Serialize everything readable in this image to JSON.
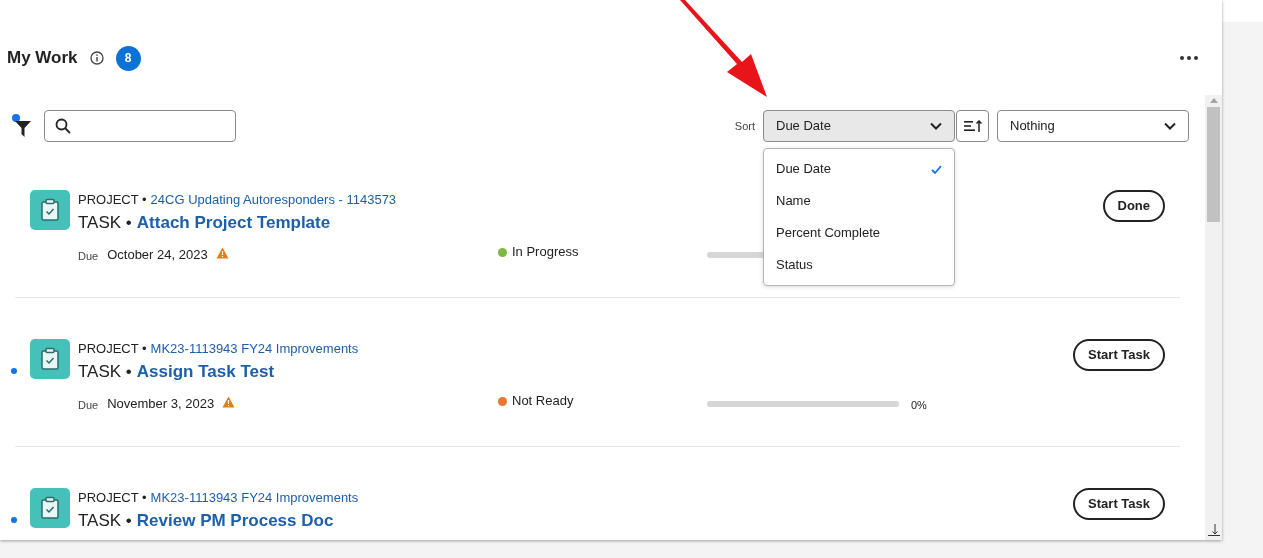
{
  "header": {
    "title": "My Work",
    "count": "8"
  },
  "filter": {
    "active": true
  },
  "sort": {
    "label": "Sort",
    "value": "Due Date",
    "open": true,
    "options": [
      {
        "label": "Due Date",
        "selected": true
      },
      {
        "label": "Name",
        "selected": false
      },
      {
        "label": "Percent Complete",
        "selected": false
      },
      {
        "label": "Status",
        "selected": false
      }
    ]
  },
  "group_by": {
    "value": "Nothing"
  },
  "tasks": [
    {
      "unread": false,
      "project_label": "PROJECT •",
      "project": "24CG Updating Autoresponders - 1143573",
      "task_label": "TASK •",
      "task": "Attach Project Template",
      "due_label": "Due",
      "due": "October 24, 2023",
      "overdue": true,
      "status": "In Progress",
      "color": "#7cb944",
      "level": 0,
      "action": "Done"
    },
    {
      "unread": true,
      "project_label": "PROJECT •",
      "project": "MK23-1113943 FY24 Improvements",
      "task_label": "TASK •",
      "task": "Assign Task Test",
      "due_label": "Due",
      "due": "November 3, 2023",
      "overdue": true,
      "status": "Not Ready",
      "color": "#e8772e",
      "level": 0,
      "percent": "0%",
      "action": "Start Task"
    },
    {
      "unread": true,
      "project_label": "PROJECT •",
      "project": "MK23-1113943 FY24 Improvements",
      "task_label": "TASK •",
      "task": "Review PM Process Doc",
      "action": "Start Task"
    }
  ]
}
